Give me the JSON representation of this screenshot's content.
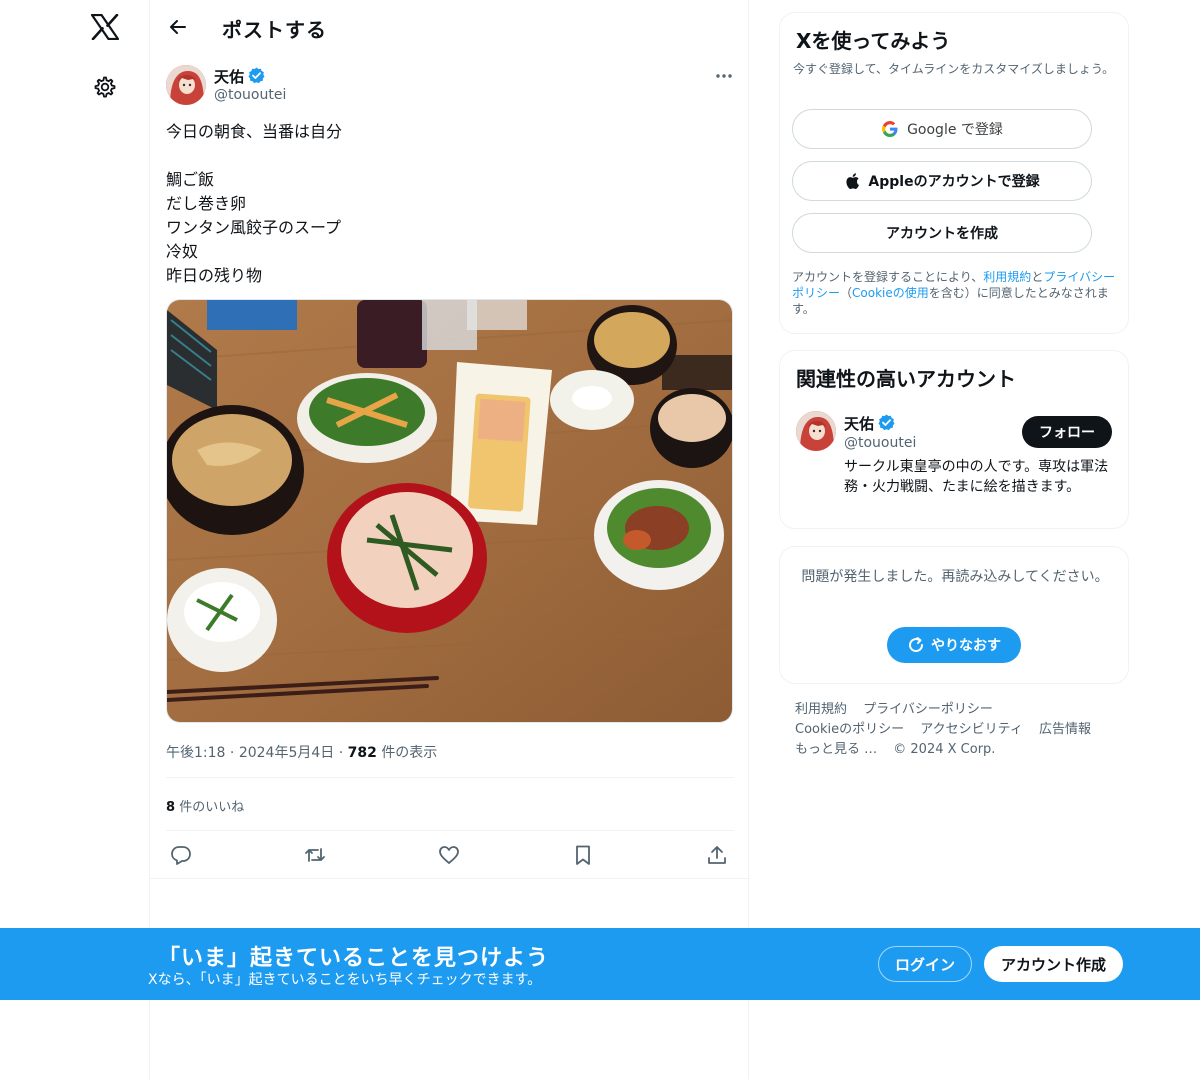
{
  "nav": {
    "logo_icon": "x-logo-icon",
    "settings_icon": "gear-icon"
  },
  "header": {
    "title": "ポストする",
    "back_icon": "arrow-left-icon"
  },
  "tweet": {
    "author_name": "天佑",
    "author_handle": "@tououtei",
    "lines": [
      "今日の朝食、当番は自分",
      "",
      "鯛ご飯",
      "だし巻き卵",
      "ワンタン風餃子のスープ",
      "冷奴",
      "昨日の残り物"
    ],
    "time": "午後1:18",
    "date": "2024年5月4日",
    "views": "782",
    "views_label": "件の表示",
    "likes": "8",
    "likes_label": "件のいいね"
  },
  "signup": {
    "title": "Xを使ってみよう",
    "subtitle": "今すぐ登録して、タイムラインをカスタマイズしましょう。",
    "google": "Google で登録",
    "apple": "Appleのアカウントで登録",
    "create": "アカウントを作成",
    "terms_1": "アカウントを登録することにより、",
    "terms_link1": "利用規約",
    "terms_2": "と",
    "terms_link2": "プライバシーポリシー",
    "terms_3": "（",
    "terms_link3": "Cookieの使用",
    "terms_4": "を含む）に同意したとみなされます。"
  },
  "related": {
    "title": "関連性の高いアカウント",
    "name": "天佑",
    "handle": "@tououtei",
    "follow": "フォロー",
    "bio": "サークル東皇亭の中の人です。専攻は軍法務・火力戦闘、たまに絵を描きます。"
  },
  "error": {
    "text": "問題が発生しました。再読み込みしてください。",
    "retry": "やりなおす"
  },
  "footer": {
    "links": [
      "利用規約",
      "プライバシーポリシー",
      "Cookieのポリシー",
      "アクセシビリティ",
      "広告情報",
      "もっと見る …",
      "© 2024 X Corp."
    ]
  },
  "banner": {
    "title": "「いま」起きていることを見つけよう",
    "subtitle": "Xなら、「いま」起きていることをいち早くチェックできます。",
    "login": "ログイン",
    "register": "アカウント作成"
  },
  "colors": {
    "accent": "#1d9bf0",
    "text": "#0f1419",
    "muted": "#536471"
  }
}
